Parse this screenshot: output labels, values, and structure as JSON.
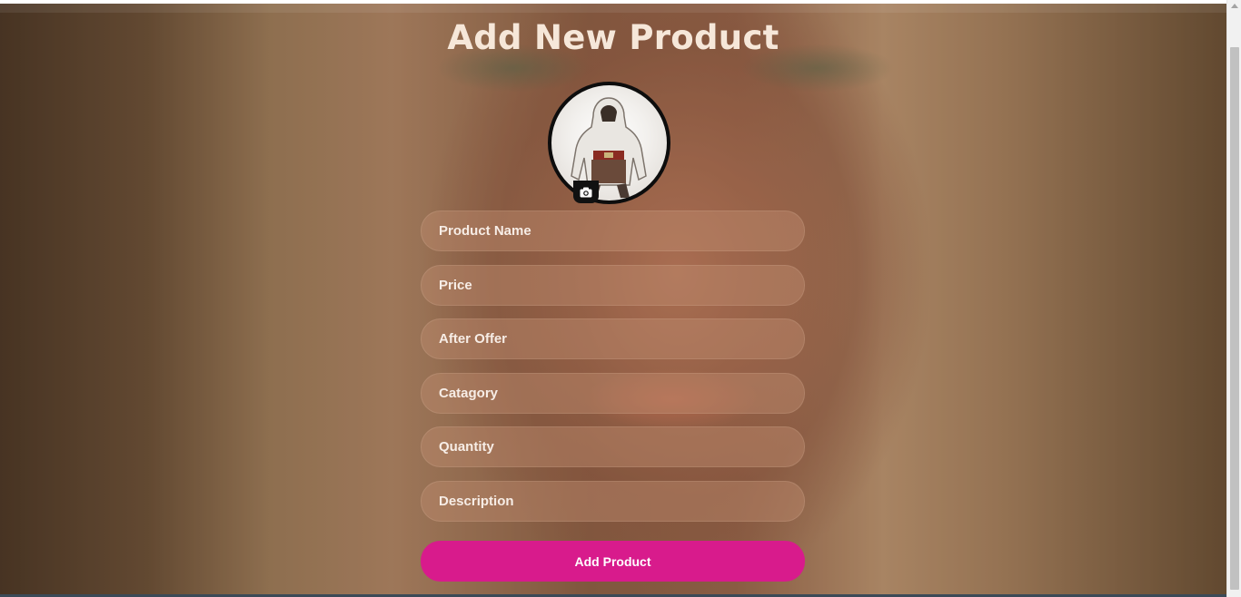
{
  "page": {
    "title": "Add New Product"
  },
  "avatar": {
    "icon": "camera-icon"
  },
  "form": {
    "fields": [
      {
        "name": "product-name",
        "placeholder": "Product Name",
        "value": ""
      },
      {
        "name": "price",
        "placeholder": "Price",
        "value": ""
      },
      {
        "name": "after-offer",
        "placeholder": "After Offer",
        "value": ""
      },
      {
        "name": "catagory",
        "placeholder": "Catagory",
        "value": ""
      },
      {
        "name": "quantity",
        "placeholder": "Quantity",
        "value": ""
      },
      {
        "name": "description",
        "placeholder": "Description",
        "value": ""
      }
    ],
    "submit_label": "Add Product"
  },
  "colors": {
    "accent": "#d81b8c",
    "title": "#f6e7d9",
    "field_bg": "rgba(190,140,110,0.45)"
  }
}
